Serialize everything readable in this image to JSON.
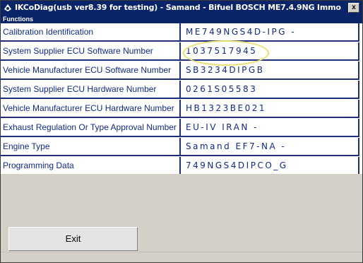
{
  "window": {
    "title": "IKCoDiag(usb ver8.39 for testing) - Samand - Bifuel BOSCH ME7.4.9NG Immo",
    "close_label": "x"
  },
  "section": {
    "header": "Functions"
  },
  "rows": [
    {
      "label": "Calibration Identification",
      "value": "ME749NGS4D-IPG -"
    },
    {
      "label": "System Supplier ECU Software Number",
      "value": "1037517945"
    },
    {
      "label": "Vehicle Manufacturer ECU Software Number",
      "value": "SB3234DIPGB"
    },
    {
      "label": "System Supplier ECU Hardware Number",
      "value": "0261S05583"
    },
    {
      "label": "Vehicle Manufacturer ECU Hardware Number",
      "value": "HB1323BE021"
    },
    {
      "label": "Exhaust Regulation Or Type Approval Number",
      "value": "EU-IV IRAN -"
    },
    {
      "label": "Engine Type",
      "value": "Samand EF7-NA -"
    },
    {
      "label": "Programming Data",
      "value": "749NGS4DIPCO_G"
    }
  ],
  "buttons": {
    "exit_label": "Exit"
  },
  "colors": {
    "title_bar": "#0a246a",
    "grid_text": "#0f2a8a",
    "grid_lines": "#1f2d7a",
    "highlight_ring": "#e8e070",
    "panel": "#d4d0c8"
  }
}
